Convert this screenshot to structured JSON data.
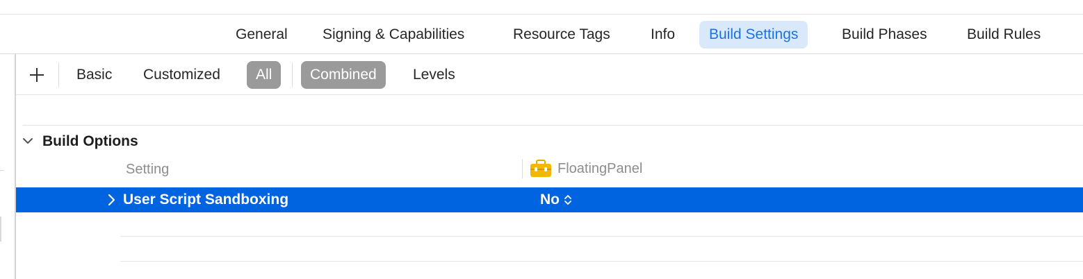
{
  "tabs": [
    {
      "label": "General",
      "active": false
    },
    {
      "label": "Signing & Capabilities",
      "active": false
    },
    {
      "label": "Resource Tags",
      "active": false
    },
    {
      "label": "Info",
      "active": false
    },
    {
      "label": "Build Settings",
      "active": true
    },
    {
      "label": "Build Phases",
      "active": false
    },
    {
      "label": "Build Rules",
      "active": false
    }
  ],
  "filters": {
    "add_icon": "plus-icon",
    "basic": "Basic",
    "customized": "Customized",
    "all": "All",
    "combined": "Combined",
    "levels": "Levels",
    "selected_scope": "All",
    "selected_view": "Combined"
  },
  "section": {
    "title": "Build Options",
    "expanded": true
  },
  "columns": {
    "setting": "Setting",
    "target": "FloatingPanel",
    "target_icon": "toolbox-icon"
  },
  "rows": [
    {
      "label": "User Script Sandboxing",
      "value": "No",
      "selected": true
    }
  ],
  "colors": {
    "accent": "#1a73e6",
    "tab_active_bg": "#d9e8fb",
    "selection_bg": "#0064e0",
    "segment_selected_bg": "#9a9a9a",
    "toolbox_yellow": "#f5b800"
  }
}
